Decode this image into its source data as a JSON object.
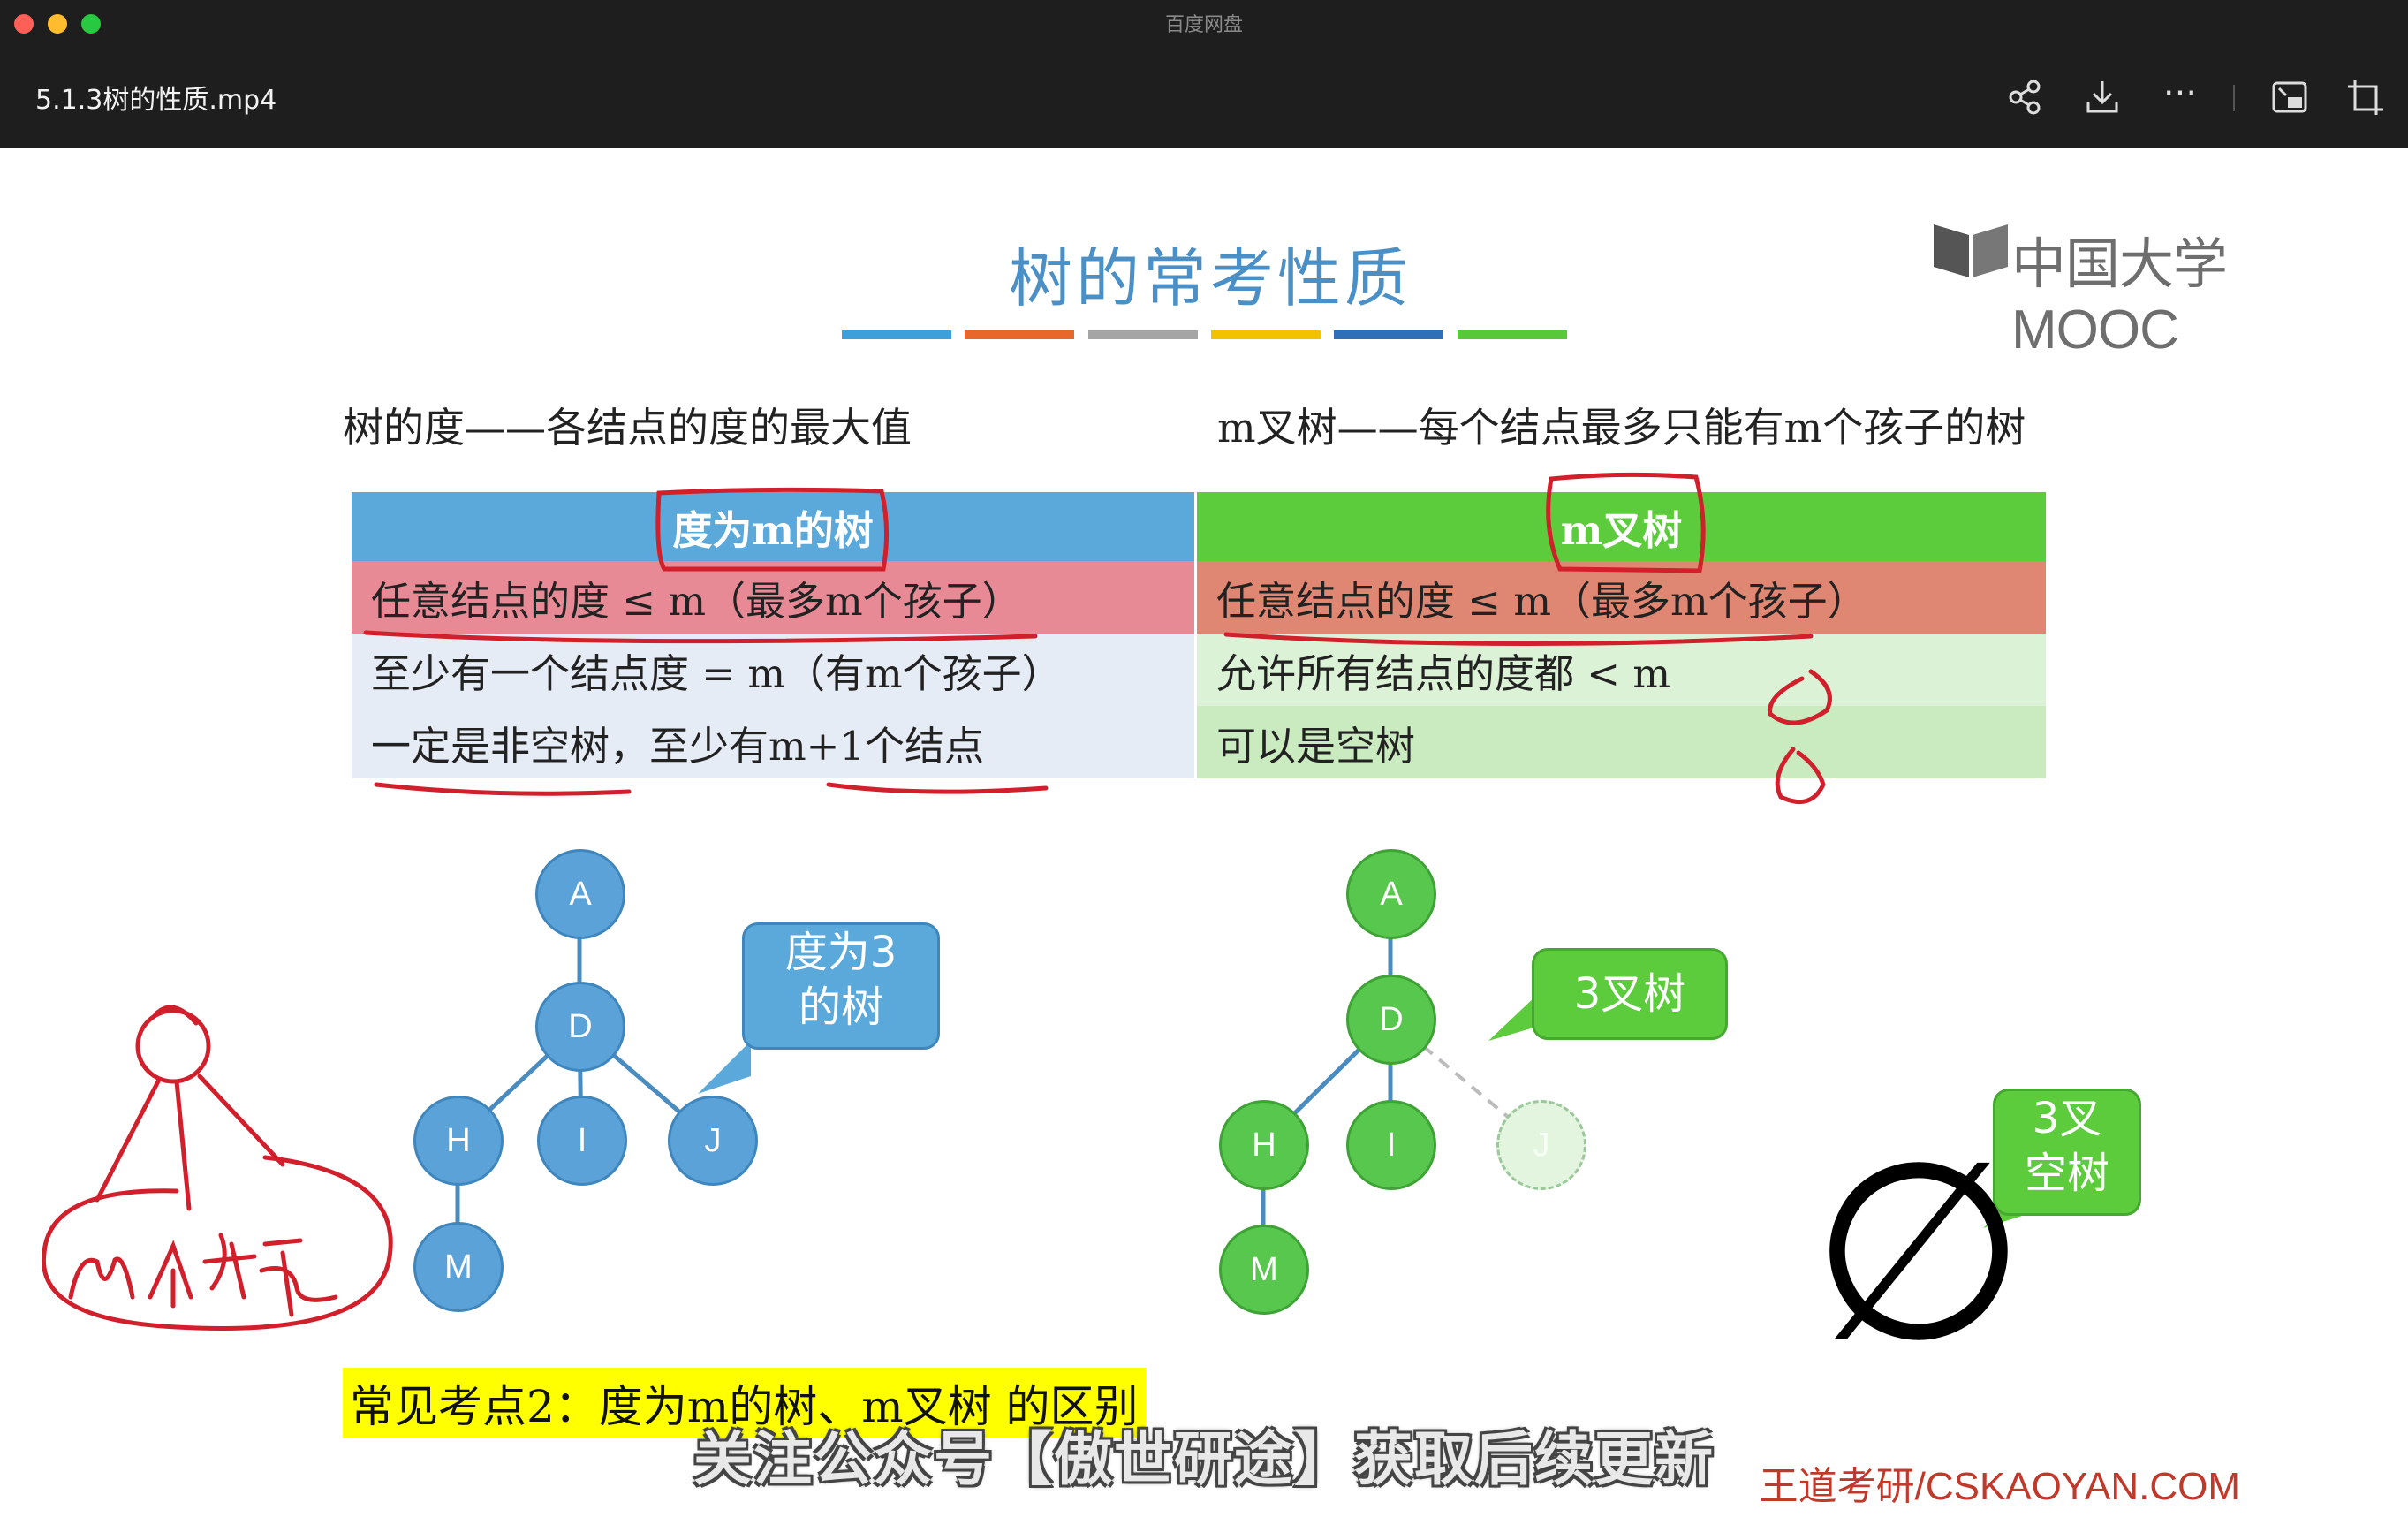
{
  "window": {
    "app_title": "百度网盘",
    "file_title": "5.1.3树的性质.mp4",
    "controls": [
      "share-icon",
      "download-icon",
      "more-icon",
      "pip-icon",
      "crop-icon"
    ],
    "more_label": "···"
  },
  "slide": {
    "title": "树的常考性质",
    "logo_text": "中国大学MOOC",
    "bar_colors": [
      "#3ea0d8",
      "#e8672a",
      "#a5a5a5",
      "#f2c200",
      "#2e6fb7",
      "#58c838"
    ],
    "def_left": "树的度——各结点的度的最大值",
    "def_right": "m叉树——每个结点最多只能有m个孩子的树",
    "table": {
      "headers": [
        "度为m的树",
        "m叉树"
      ],
      "rows": [
        [
          "任意结点的度 ≤ m（最多m个孩子）",
          "任意结点的度 ≤ m（最多m个孩子）"
        ],
        [
          "至少有一个结点度 = m（有m个孩子）",
          "允许所有结点的度都 < m"
        ],
        [
          "一定是非空树，至少有m+1个结点",
          "可以是空树"
        ]
      ],
      "colors": {
        "header_left": "#5aa9da",
        "header_right": "#5ccc3c",
        "row1_left": "#e88a96",
        "row1_right": "#e08773",
        "row_left": "#e6ecf5",
        "row_right": "#dcf2d6",
        "row3_right": "#c9ebbf"
      }
    },
    "tree_left": {
      "nodes": [
        "A",
        "D",
        "H",
        "I",
        "J",
        "M"
      ],
      "callout": [
        "度为3",
        "的树"
      ]
    },
    "tree_right": {
      "nodes": [
        "A",
        "D",
        "H",
        "I",
        "J",
        "M"
      ],
      "callout": "3叉树",
      "empty_callout": [
        "3叉",
        "空树"
      ],
      "empty_symbol": "∅"
    },
    "highlight": "常见考点2：度为m的树、m叉树 的区别",
    "subtitle": "关注公众号【傲世研途】获取后续更新",
    "watermark": "王道考研/CSKAOYAN.COM"
  }
}
